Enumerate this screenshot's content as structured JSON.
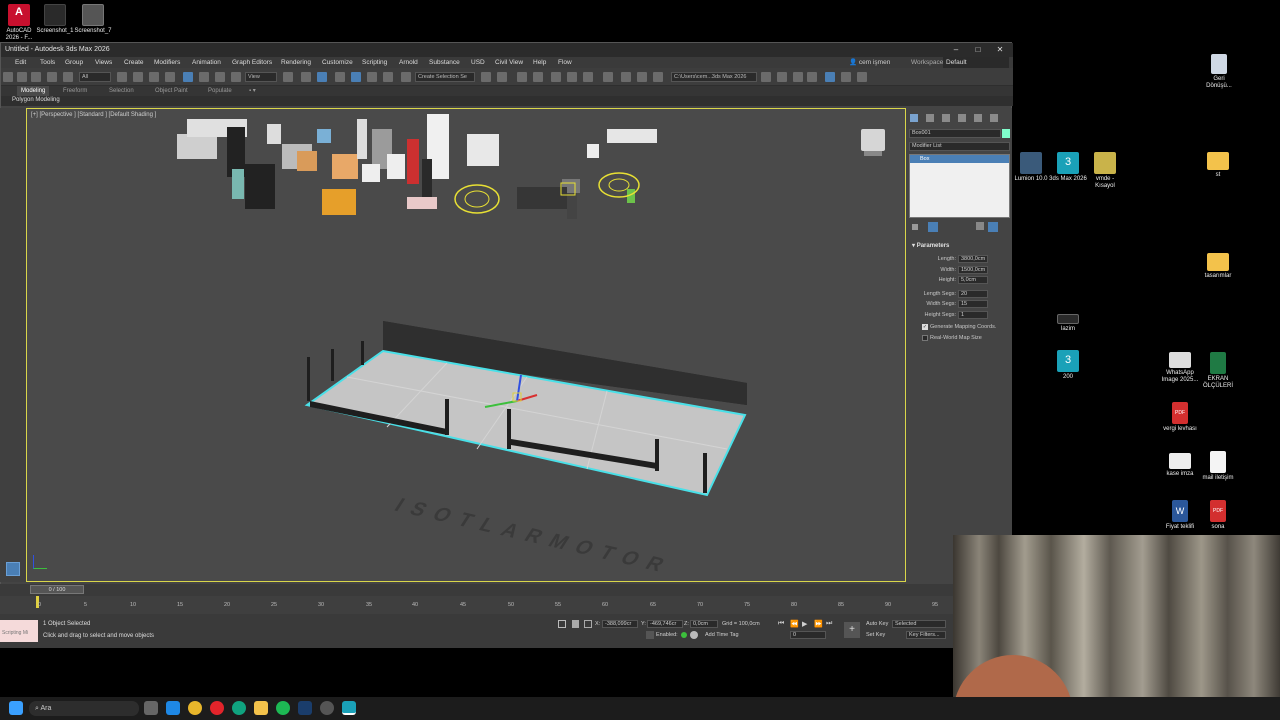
{
  "top_icons": [
    {
      "label": "AutoCAD 2026 - F...",
      "icon": "autocad-icon"
    },
    {
      "label": "Screenshot_1",
      "icon": "screenshot-icon"
    },
    {
      "label": "Screenshot_7",
      "icon": "screenshot-icon"
    }
  ],
  "window": {
    "title": "Untitled - Autodesk 3ds Max 2026",
    "user": "cem işmen",
    "workspaces_label": "Workspaces:",
    "workspace": "Default"
  },
  "menus": [
    "Edit",
    "Tools",
    "Group",
    "Views",
    "Create",
    "Modifiers",
    "Animation",
    "Graph Editors",
    "Rendering",
    "Customize",
    "Scripting",
    "Arnold",
    "Substance",
    "USD",
    "Civil View",
    "Help",
    "Flow"
  ],
  "toolbar": {
    "filter": "All",
    "view": "View",
    "selection_set": "Create Selection Se",
    "path": "C:\\Users\\cem...3ds Max 2026"
  },
  "ribbon_tabs": [
    "Modeling",
    "Freeform",
    "Selection",
    "Object Paint",
    "Populate"
  ],
  "polygon_modeling": "Polygon Modeling",
  "viewport": {
    "label": "[+] [Perspective ] [Standard ] [Default Shading ]",
    "ground_text": "ISOTLARMOTOR"
  },
  "command_panel": {
    "object_name": "Box001",
    "modifier_list": "Modifier List",
    "stack_item": "Box",
    "parameters_title": "Parameters",
    "params": [
      {
        "label": "Length:",
        "value": "3800,0cm"
      },
      {
        "label": "Width:",
        "value": "1500,0cm"
      },
      {
        "label": "Height:",
        "value": "5,0cm"
      },
      {
        "label": "Length Segs:",
        "value": "20"
      },
      {
        "label": "Width Segs:",
        "value": "15"
      },
      {
        "label": "Height Segs:",
        "value": "1"
      }
    ],
    "gen_mapping": "Generate Mapping Coords.",
    "real_world": "Real-World Map Size"
  },
  "timeline": {
    "frame": "0 / 100",
    "ticks": [
      "0",
      "5",
      "10",
      "15",
      "20",
      "25",
      "30",
      "35",
      "40",
      "45",
      "50",
      "55",
      "60",
      "65",
      "70",
      "75",
      "80",
      "85",
      "90",
      "95"
    ]
  },
  "status": {
    "selected": "1 Object Selected",
    "hint": "Click and drag to select and move objects",
    "x_label": "X:",
    "x": "-388,099cr",
    "y_label": "Y:",
    "y": "-469,746cr",
    "z_label": "Z:",
    "z": "0,0cm",
    "grid": "Grid = 100,0cm",
    "enabled": "Enabled:",
    "add_time_tag": "Add Time Tag",
    "auto_key": "Auto Key",
    "set_key": "Set Key",
    "selected_dropdown": "Selected",
    "key_filters": "Key Filters...",
    "maxscript": "Scripting Mi"
  },
  "desktop_icons": [
    {
      "label": "Geri Dönüşü...",
      "icon": "recycle-bin-icon"
    },
    {
      "label": "Lumion 10.0",
      "icon": "lumion-icon"
    },
    {
      "label": "3ds Max 2026",
      "icon": "3dsmax-icon"
    },
    {
      "label": "vmde - Kısayol",
      "icon": "vmde-icon"
    },
    {
      "label": "st",
      "icon": "folder-icon"
    },
    {
      "label": "tasarımlar",
      "icon": "folder-icon"
    },
    {
      "label": "lazim",
      "icon": "file-icon"
    },
    {
      "label": "200",
      "icon": "3dsmax-icon"
    },
    {
      "label": "WhatsApp Image 2025...",
      "icon": "image-icon"
    },
    {
      "label": "EKRAN ÖLÇÜLERİ",
      "icon": "excel-icon"
    },
    {
      "label": "vergi levhası",
      "icon": "pdf-icon"
    },
    {
      "label": "kase imza",
      "icon": "image-icon"
    },
    {
      "label": "mail iletişim",
      "icon": "text-file-icon"
    },
    {
      "label": "Fiyat teklifi",
      "icon": "word-icon"
    },
    {
      "label": "sona",
      "icon": "pdf-icon"
    }
  ],
  "taskbar": {
    "search": "Ara"
  },
  "colors": {
    "selection": "#49e0e8",
    "viewport_border": "#d9d64a",
    "accent": "#4a7fb5"
  }
}
